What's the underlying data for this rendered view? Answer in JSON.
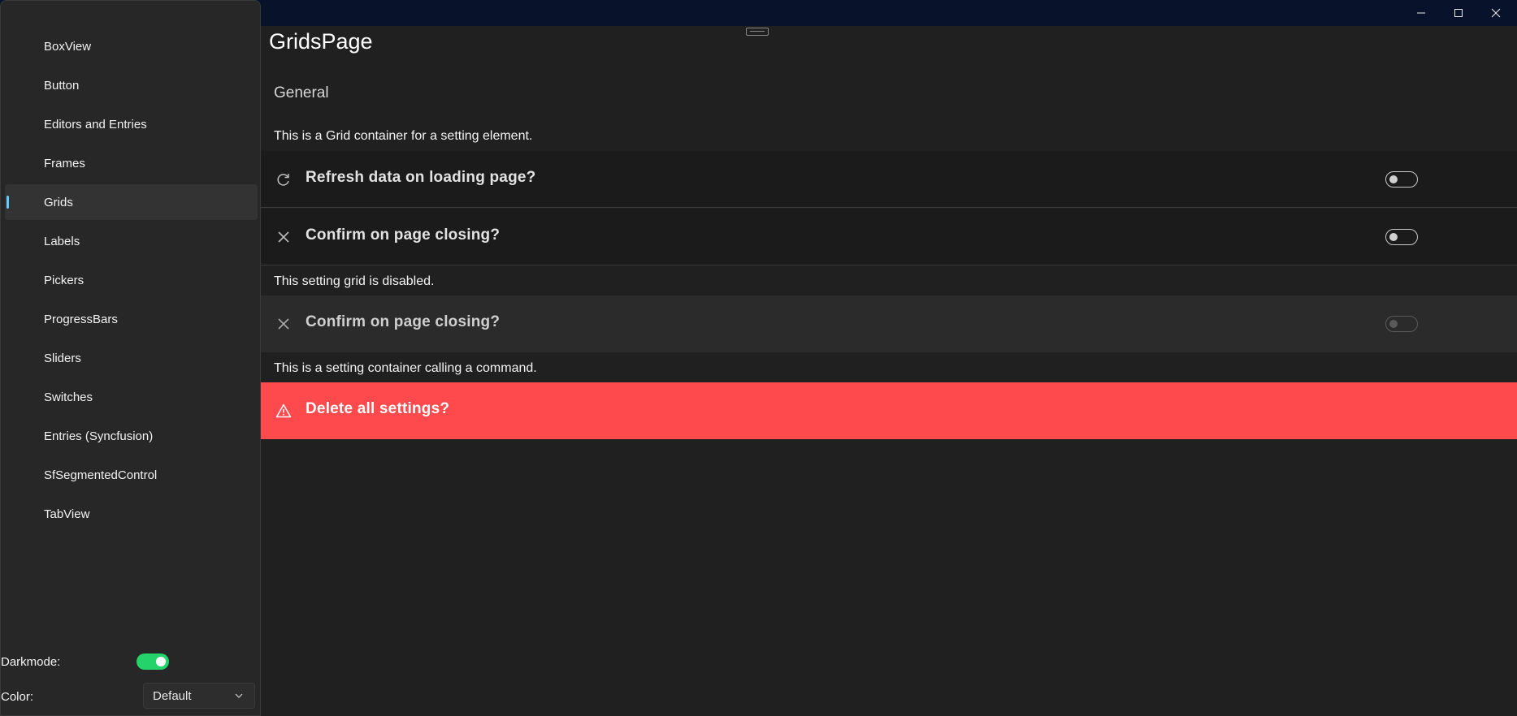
{
  "window": {
    "minimize_icon": "minimize-icon",
    "maximize_icon": "maximize-icon",
    "close_icon": "close-icon"
  },
  "sidebar": {
    "items": [
      {
        "label": "BoxView",
        "selected": false
      },
      {
        "label": "Button",
        "selected": false
      },
      {
        "label": "Editors and Entries",
        "selected": false
      },
      {
        "label": "Frames",
        "selected": false
      },
      {
        "label": "Grids",
        "selected": true
      },
      {
        "label": "Labels",
        "selected": false
      },
      {
        "label": "Pickers",
        "selected": false
      },
      {
        "label": "ProgressBars",
        "selected": false
      },
      {
        "label": "Sliders",
        "selected": false
      },
      {
        "label": "Switches",
        "selected": false
      },
      {
        "label": "Entries (Syncfusion)",
        "selected": false
      },
      {
        "label": "SfSegmentedControl",
        "selected": false
      },
      {
        "label": "TabView",
        "selected": false
      }
    ],
    "darkmode_label": "Darkmode:",
    "darkmode_on": true,
    "color_label": "Color:",
    "color_value": "Default"
  },
  "page": {
    "title": "GridsPage",
    "section": "General",
    "desc_grid": "This is a Grid container for a setting element.",
    "refresh_label": "Refresh data on loading page?",
    "refresh_on": false,
    "confirm_label": "Confirm on page closing?",
    "confirm_on": false,
    "desc_disabled": "This setting grid is disabled.",
    "confirm_disabled_label": "Confirm on page closing?",
    "desc_command": "This is a setting container calling a command.",
    "delete_label": "Delete all settings?"
  },
  "colors": {
    "accent": "#60cdff",
    "toggle_on": "#24d46a",
    "danger": "#fe4a4c",
    "titlebar": "#08132b"
  }
}
